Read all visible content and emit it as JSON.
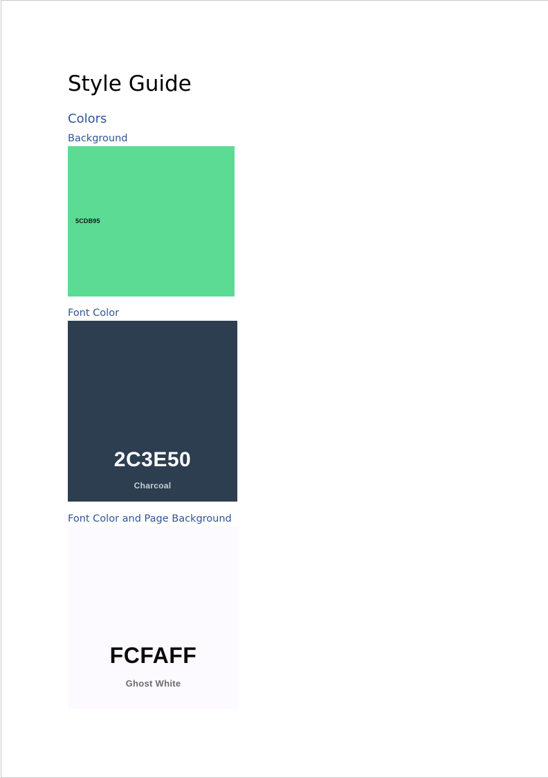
{
  "document": {
    "title": "Style Guide",
    "section_heading": "Colors"
  },
  "swatches": [
    {
      "heading": "Background",
      "color": "#5CDB95",
      "code": "5CDB95"
    },
    {
      "heading": "Font Color",
      "color": "#2C3E50",
      "code": "2C3E50",
      "name": "Charcoal",
      "code_color": "#ffffff",
      "name_color": "#c9ced4"
    },
    {
      "heading": "Font Color and Page Background",
      "color": "#FCFAFF",
      "code": "FCFAFF",
      "name": "Ghost White",
      "code_color": "#0a0a0a",
      "name_color": "#6b6b6b"
    }
  ]
}
